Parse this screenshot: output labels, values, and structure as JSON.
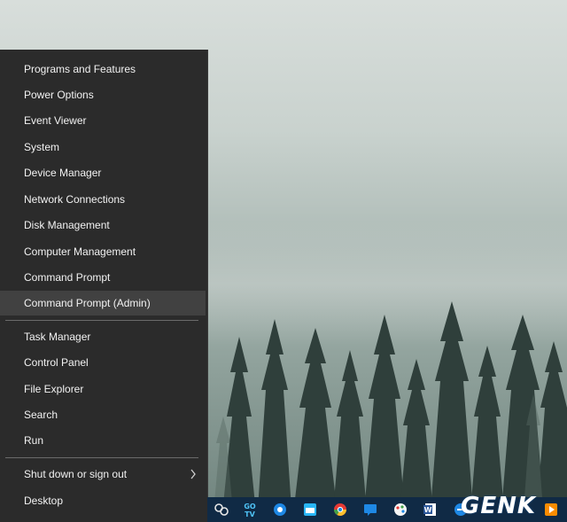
{
  "context_menu": {
    "items": [
      {
        "label": "Programs and Features"
      },
      {
        "label": "Power Options"
      },
      {
        "label": "Event Viewer"
      },
      {
        "label": "System"
      },
      {
        "label": "Device Manager"
      },
      {
        "label": "Network Connections"
      },
      {
        "label": "Disk Management"
      },
      {
        "label": "Computer Management"
      },
      {
        "label": "Command Prompt"
      },
      {
        "label": "Command Prompt (Admin)",
        "highlighted": true
      },
      {
        "label": "Task Manager"
      },
      {
        "label": "Control Panel"
      },
      {
        "label": "File Explorer"
      },
      {
        "label": "Search"
      },
      {
        "label": "Run"
      },
      {
        "label": "Shut down or sign out",
        "has_submenu": true
      },
      {
        "label": "Desktop"
      }
    ]
  },
  "taskbar": {
    "icons": [
      "link-icon",
      "gotv-icon",
      "browser-icon",
      "calendar-app-icon",
      "chrome-icon",
      "chat-icon",
      "paint-icon",
      "word-icon",
      "edge-icon",
      "media-player-icon"
    ],
    "gotv_label": "GO TV"
  },
  "watermark": {
    "text": "GENK"
  },
  "colors": {
    "menu_bg": "#2b2b2b",
    "menu_highlight": "#414141",
    "taskbar_bg": "#102a45"
  }
}
